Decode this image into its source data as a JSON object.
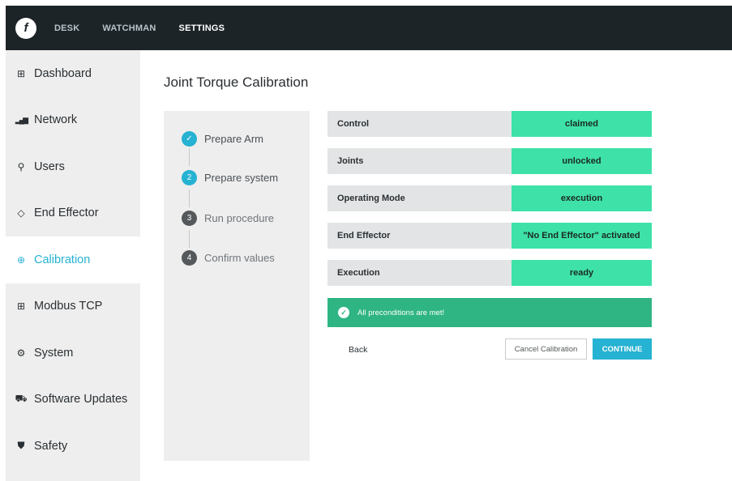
{
  "topbar": {
    "logo": "f",
    "nav": [
      {
        "label": "DESK",
        "active": false
      },
      {
        "label": "WATCHMAN",
        "active": false
      },
      {
        "label": "SETTINGS",
        "active": true
      }
    ]
  },
  "sidebar": {
    "items": [
      {
        "label": "Dashboard",
        "icon": "dashboard-icon",
        "glyph": "⊞"
      },
      {
        "label": "Network",
        "icon": "network-icon",
        "glyph": "▂▄▆"
      },
      {
        "label": "Users",
        "icon": "users-icon",
        "glyph": "⚲"
      },
      {
        "label": "End Effector",
        "icon": "end-effector-icon",
        "glyph": "◇"
      },
      {
        "label": "Calibration",
        "icon": "calibration-icon",
        "glyph": "⊕"
      },
      {
        "label": "Modbus TCP",
        "icon": "modbus-icon",
        "glyph": "⊞"
      },
      {
        "label": "System",
        "icon": "system-icon",
        "glyph": "⚙"
      },
      {
        "label": "Software Updates",
        "icon": "software-updates-icon",
        "glyph": "⛟"
      },
      {
        "label": "Safety",
        "icon": "safety-icon",
        "glyph": "⛊"
      }
    ],
    "active_index": 4
  },
  "page": {
    "title": "Joint Torque Calibration"
  },
  "steps": [
    {
      "number": "✓",
      "label": "Prepare Arm",
      "state": "done"
    },
    {
      "number": "2",
      "label": "Prepare system",
      "state": "current"
    },
    {
      "number": "3",
      "label": "Run procedure",
      "state": "todo"
    },
    {
      "number": "4",
      "label": "Confirm values",
      "state": "todo"
    }
  ],
  "conditions": [
    {
      "label": "Control",
      "value": "claimed"
    },
    {
      "label": "Joints",
      "value": "unlocked"
    },
    {
      "label": "Operating Mode",
      "value": "execution"
    },
    {
      "label": "End Effector",
      "value": "\"No End Effector\" activated"
    },
    {
      "label": "Execution",
      "value": "ready"
    }
  ],
  "banner": {
    "text": "All preconditions are met!"
  },
  "actions": {
    "back": "Back",
    "cancel": "Cancel Calibration",
    "continue": "CONTINUE"
  },
  "colors": {
    "topbar": "#1c2428",
    "accent": "#26b2d2",
    "condition_ok": "#3ee2a8",
    "banner_success": "#2fb583"
  }
}
